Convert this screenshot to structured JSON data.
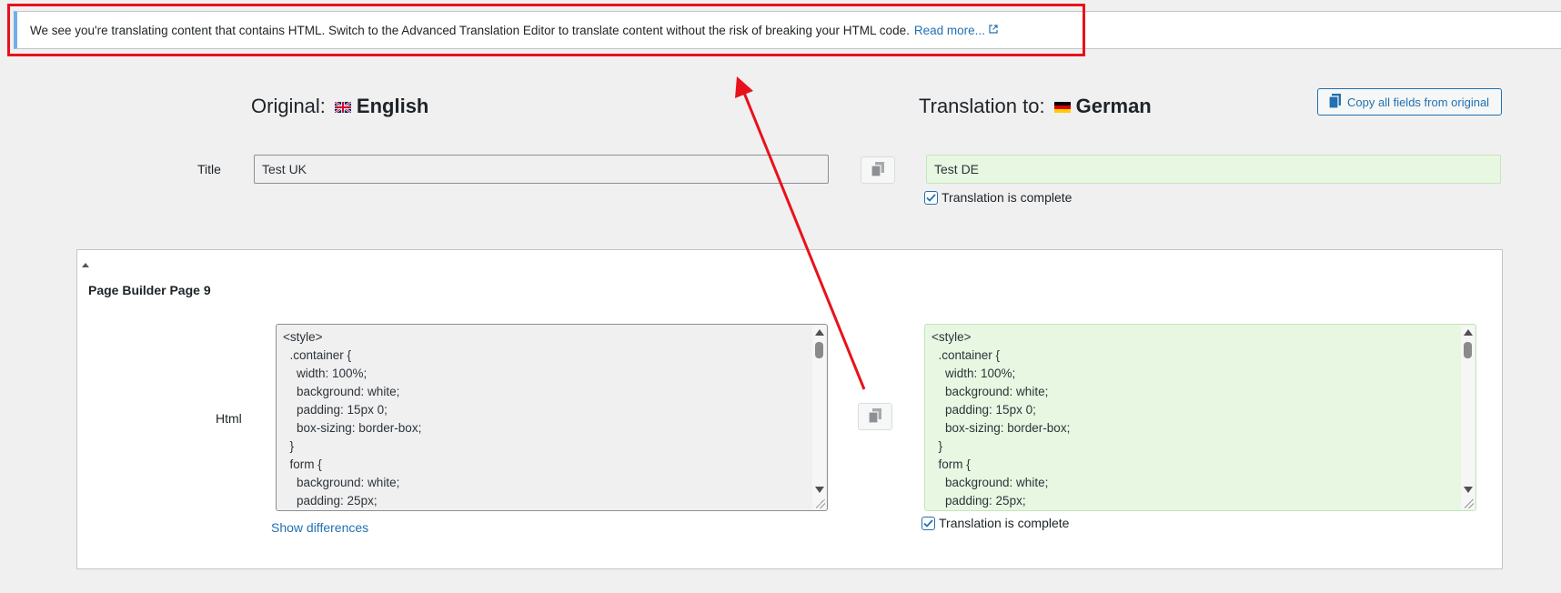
{
  "notice": {
    "message": "We see you're translating content that contains HTML. Switch to the Advanced Translation Editor to translate content without the risk of breaking your HTML code.",
    "link_label": "Read more..."
  },
  "original": {
    "label": "Original:",
    "language": "English"
  },
  "translation": {
    "label": "Translation to:",
    "language": "German"
  },
  "copy_all_label": "Copy all fields from original",
  "title_field": {
    "label": "Title",
    "original_value": "Test UK",
    "translated_value": "Test DE",
    "complete_label": "Translation is complete",
    "complete_checked": true
  },
  "section": {
    "title": "Page Builder Page 9",
    "html_field": {
      "label": "Html",
      "original_value": "<style>\n  .container {\n    width: 100%;\n    background: white;\n    padding: 15px 0;\n    box-sizing: border-box;\n  }\n  form {\n    background: white;\n    padding: 25px;",
      "translated_value": "<style>\n  .container {\n    width: 100%;\n    background: white;\n    padding: 15px 0;\n    box-sizing: border-box;\n  }\n  form {\n    background: white;\n    padding: 25px;",
      "show_differences_label": "Show differences",
      "complete_label": "Translation is complete",
      "complete_checked": true
    }
  },
  "colors": {
    "accent": "#2271b1",
    "annotation": "#e8121a",
    "translated_bg": "#e7f7e2"
  },
  "icons": [
    "external-link-icon",
    "uk-flag-icon",
    "germany-flag-icon",
    "copy-icon",
    "checkmark-icon"
  ]
}
